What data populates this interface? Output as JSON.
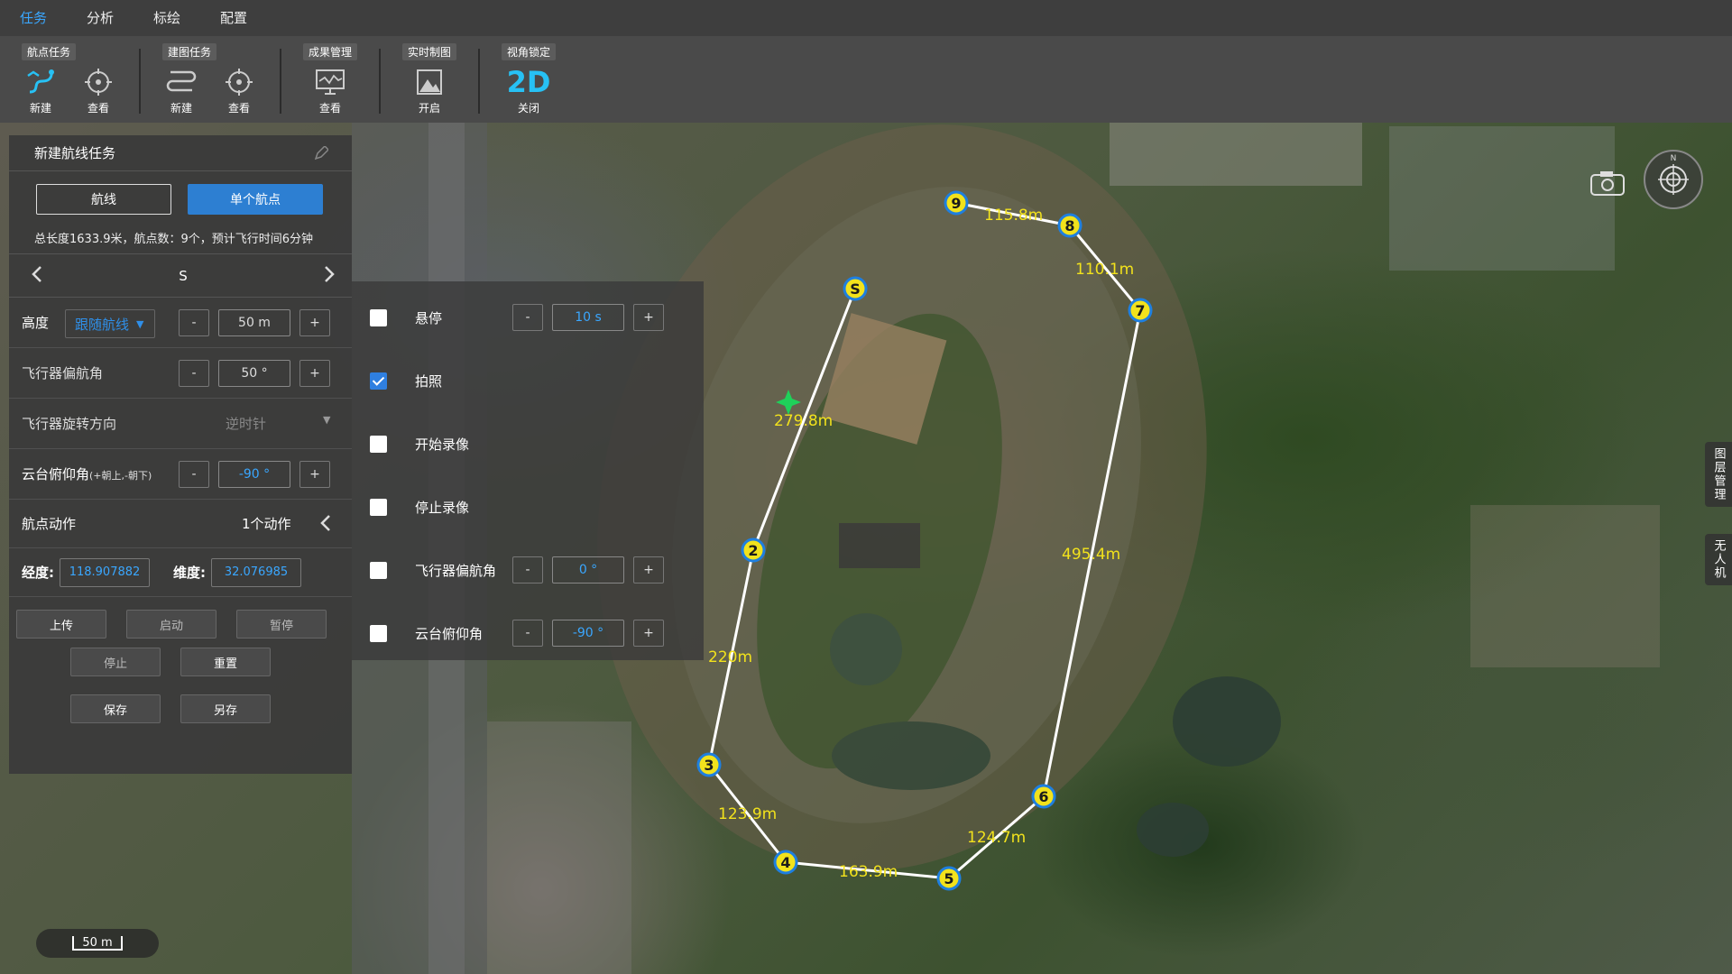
{
  "menu": [
    "任务",
    "分析",
    "标绘",
    "配置"
  ],
  "toolbar": {
    "groups": [
      {
        "label": "航点任务",
        "buttons": [
          "新建",
          "查看"
        ]
      },
      {
        "label": "建图任务",
        "buttons": [
          "新建",
          "查看"
        ]
      },
      {
        "label": "成果管理",
        "buttons": [
          "查看"
        ]
      },
      {
        "label": "实时制图",
        "buttons": [
          "开启"
        ]
      },
      {
        "label": "视角锁定",
        "buttons": [
          "关闭"
        ],
        "icon_text": "2D"
      }
    ]
  },
  "panel": {
    "title": "新建航线任务",
    "tabs": [
      "航线",
      "单个航点"
    ],
    "summary": "总长度1633.9米，航点数：9个，预计飞行时间6分钟",
    "point_name": "S",
    "altitude": {
      "label": "高度",
      "mode": "跟随航线",
      "value": "50 m"
    },
    "yaw": {
      "label": "飞行器偏航角",
      "value": "50 °"
    },
    "rotation": {
      "label": "飞行器旋转方向",
      "value": "逆时针"
    },
    "gimbal": {
      "label": "云台俯仰角",
      "hint": "(+朝上,-朝下)",
      "value": "-90 °"
    },
    "waypoint_action": {
      "label": "航点动作",
      "count": "1个动作"
    },
    "lng": {
      "label": "经度:",
      "value": "118.907882"
    },
    "lat": {
      "label": "维度:",
      "value": "32.076985"
    },
    "buttons_row1": [
      "上传",
      "启动",
      "暂停"
    ],
    "buttons_row2": [
      "停止",
      "重置"
    ],
    "buttons_row3": [
      "保存",
      "另存"
    ],
    "minus": "-",
    "plus": "+"
  },
  "actions": [
    {
      "label": "悬停",
      "checked": false,
      "value": "10 s"
    },
    {
      "label": "拍照",
      "checked": true
    },
    {
      "label": "开始录像",
      "checked": false
    },
    {
      "label": "停止录像",
      "checked": false
    },
    {
      "label": "飞行器偏航角",
      "checked": false,
      "value": "0 °"
    },
    {
      "label": "云台俯仰角",
      "checked": false,
      "value": "-90 °"
    }
  ],
  "route": {
    "waypoints": [
      "S",
      "2",
      "3",
      "4",
      "5",
      "6",
      "7",
      "8",
      "9"
    ],
    "segment_labels": [
      "279.8m",
      "220m",
      "123.9m",
      "163.9m",
      "124.7m",
      "495.4m",
      "110.1m",
      "115.8m"
    ],
    "line_color": "#ffffff",
    "marker_fill": "#f2e21c",
    "marker_stroke": "#1e7fe0",
    "label_color": "#f2e21c"
  },
  "scale": "50 m",
  "side_tabs": [
    "图层管理",
    "无人机"
  ]
}
